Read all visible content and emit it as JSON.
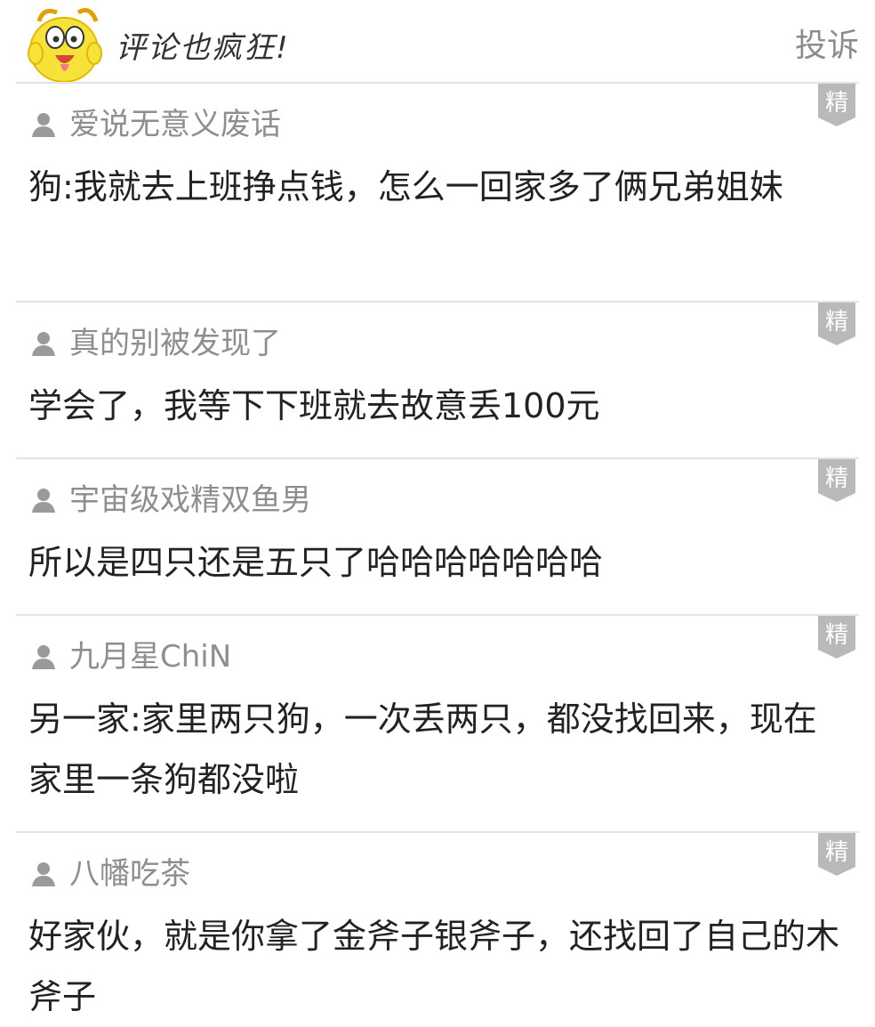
{
  "header": {
    "title": "评论也疯狂!",
    "report_label": "投诉"
  },
  "badge_label": "精",
  "comments": [
    {
      "user": "爱说无意义废话",
      "text": "狗:我就去上班挣点钱，怎么一回家多了俩兄弟姐妹"
    },
    {
      "user": "真的别被发现了",
      "text": "学会了，我等下下班就去故意丢100元"
    },
    {
      "user": "宇宙级戏精双鱼男",
      "text": "所以是四只还是五只了哈哈哈哈哈哈哈"
    },
    {
      "user": "九月星ChiN",
      "text": "另一家:家里两只狗，一次丢两只，都没找回来，现在家里一条狗都没啦"
    },
    {
      "user": "八幡吃茶",
      "text": "好家伙，就是你拿了金斧子银斧子，还找回了自己的木斧子"
    }
  ]
}
